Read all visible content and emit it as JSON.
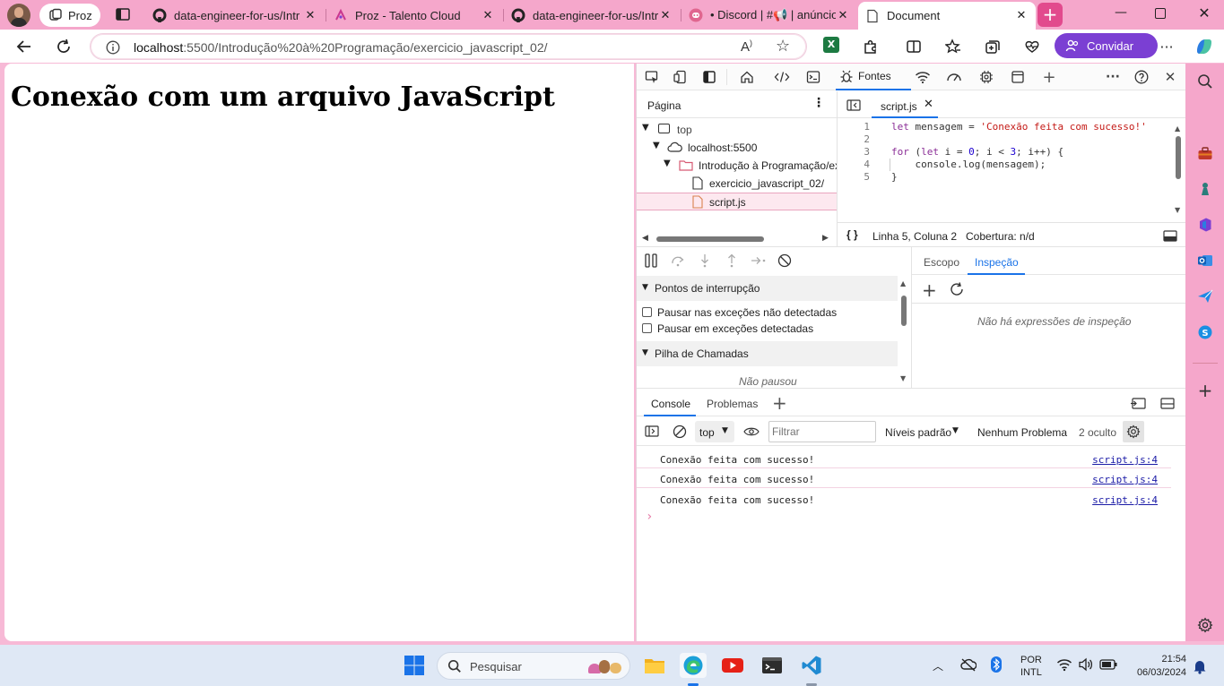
{
  "browser": {
    "profile_label": "Proz",
    "tabs": [
      {
        "title": "data-engineer-for-us/Intr",
        "favicon": "github-icon"
      },
      {
        "title": "Proz - Talento Cloud",
        "favicon": "proz-icon"
      },
      {
        "title": "data-engineer-for-us/Intr",
        "favicon": "github-icon"
      },
      {
        "title": "• Discord | #📢 | anúncio",
        "favicon": "discord-icon"
      },
      {
        "title": "Document",
        "favicon": "page-icon"
      }
    ],
    "address": {
      "host": "localhost",
      "rest": ":5500/Introdução%20à%20Programação/exercicio_javascript_02/"
    },
    "share_label": "Convidar",
    "window_controls": [
      "minimize",
      "maximize",
      "close"
    ]
  },
  "page": {
    "heading": "Conexão com um arquivo JavaScript"
  },
  "devtools": {
    "active_panel": "Fontes",
    "navigator": {
      "tab_label": "Página",
      "tree": [
        {
          "label": "top",
          "level": 0
        },
        {
          "label": "localhost:5500",
          "level": 1
        },
        {
          "label": "Introdução à Programação/ex",
          "level": 2
        },
        {
          "label": "exercicio_javascript_02/",
          "level": 3
        },
        {
          "label": "script.js",
          "level": 3,
          "selected": true
        }
      ]
    },
    "editor": {
      "file_tab": "script.js",
      "line_numbers": [
        "1",
        "2",
        "3",
        "4",
        "5"
      ],
      "code": {
        "l1_kw": "let",
        "l1_rest": " mensagem = ",
        "l1_str": "'Conexão feita com sucesso!'",
        "l3_kw1": "for",
        "l3_a": " (",
        "l3_kw2": "let",
        "l3_b": " i = ",
        "l3_n0": "0",
        "l3_c": "; i < ",
        "l3_n3": "3",
        "l3_d": "; i++) {",
        "l4": "    console.log(mensagem);",
        "l5": "}"
      },
      "status_braces": "{ }",
      "status_position": "Linha 5, Coluna 2",
      "status_coverage": "Cobertura: n/d"
    },
    "debugger": {
      "breakpoints_header": "Pontos de interrupção",
      "pause_uncaught": "Pausar nas exceções não detectadas",
      "pause_caught": "Pausar em exceções detectadas",
      "callstack_header": "Pilha de Chamadas",
      "not_paused": "Não pausou",
      "scope_tab": "Escopo",
      "watch_tab": "Inspeção",
      "no_watch": "Não há expressões de inspeção"
    },
    "drawer": {
      "tabs": [
        "Console",
        "Problemas"
      ],
      "context": "top",
      "filter_placeholder": "Filtrar",
      "levels": "Níveis padrão",
      "issues": "Nenhum Problema",
      "hidden": "2 oculto",
      "messages": [
        {
          "text": "Conexão feita com sucesso!",
          "source": "script.js:4"
        },
        {
          "text": "Conexão feita com sucesso!",
          "source": "script.js:4"
        },
        {
          "text": "Conexão feita com sucesso!",
          "source": "script.js:4"
        }
      ],
      "prompt": "›"
    }
  },
  "taskbar": {
    "search_placeholder": "Pesquisar",
    "lang_line1": "POR",
    "lang_line2": "INTL",
    "time": "21:54",
    "date": "06/03/2024"
  },
  "colors": {
    "accent": "#7b3fd3",
    "tab_strip": "#f5a7cb",
    "selected_row": "#fde8ef",
    "active_tab_underline": "#1a73e8"
  }
}
